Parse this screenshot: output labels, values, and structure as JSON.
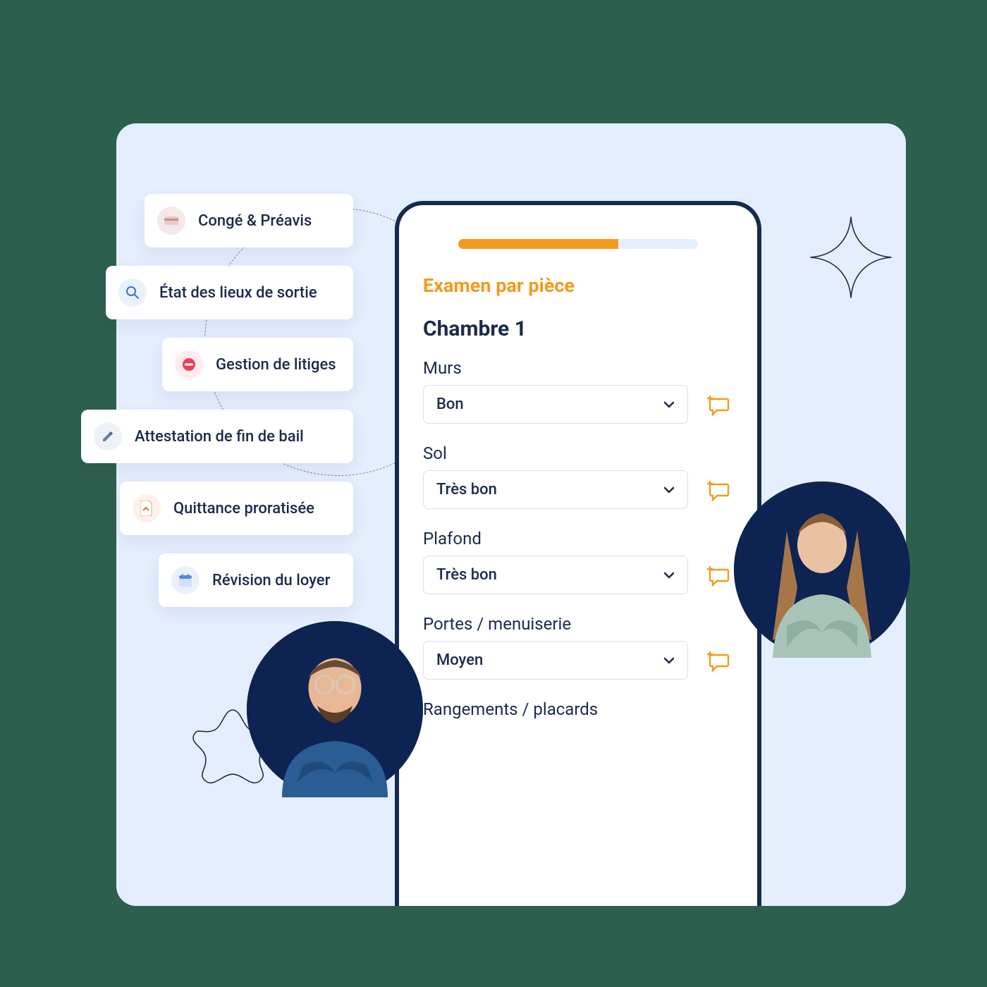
{
  "sidebar": {
    "items": [
      {
        "label": "Congé & Préavis",
        "iconName": "card-icon"
      },
      {
        "label": "État des lieux de sortie",
        "iconName": "magnifier-icon"
      },
      {
        "label": "Gestion de litiges",
        "iconName": "no-entry-icon"
      },
      {
        "label": "Attestation de fin de bail",
        "iconName": "pen-icon"
      },
      {
        "label": "Quittance proratisée",
        "iconName": "document-icon"
      },
      {
        "label": "Révision du loyer",
        "iconName": "calendar-icon"
      }
    ]
  },
  "phone": {
    "sectionTitle": "Examen par pièce",
    "roomTitle": "Chambre 1",
    "progress": {
      "filled": 2,
      "total": 3
    },
    "fields": [
      {
        "label": "Murs",
        "value": "Bon"
      },
      {
        "label": "Sol",
        "value": "Très bon"
      },
      {
        "label": "Plafond",
        "value": "Très bon"
      },
      {
        "label": "Portes / menuiserie",
        "value": "Moyen"
      },
      {
        "label": "Rangements / placards",
        "value": ""
      }
    ]
  },
  "colors": {
    "accent": "#f39a1e",
    "text": "#1c2a4a",
    "bg": "#e5eeff"
  }
}
